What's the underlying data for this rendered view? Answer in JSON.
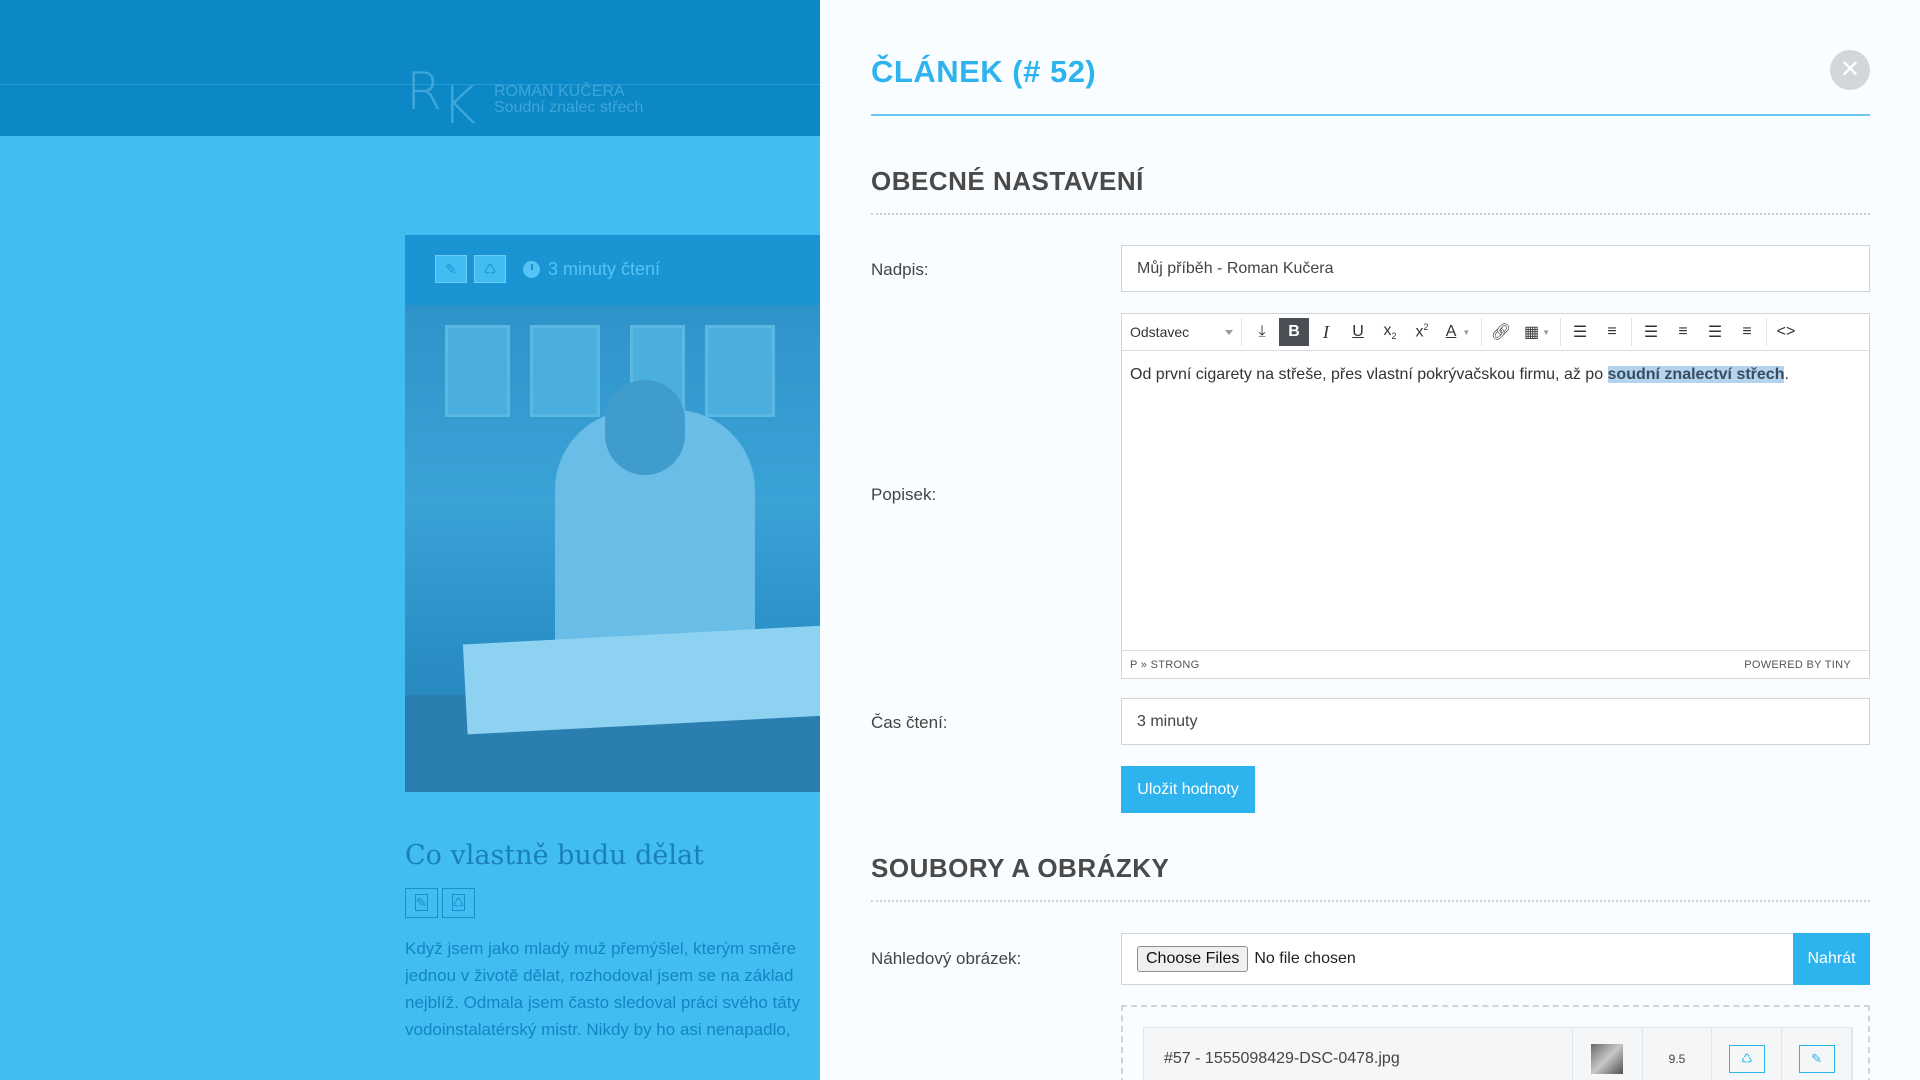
{
  "background": {
    "logo": {
      "mark_r": "R",
      "mark_k": "K",
      "name": "ROMAN KUČERA",
      "tagline": "Soudní znalec střech"
    },
    "card": {
      "edit_icon": "pencil-icon",
      "delete_icon": "recycle-icon",
      "reading_time": "3 minuty čtení"
    },
    "article": {
      "title": "Co vlastně budu dělat",
      "paragraph_lines": [
        "Když jsem jako mladý muž přemýšlel, kterým směre",
        "jednou v životě dělat, rozhodoval jsem se na základ",
        "nejblíž. Odmala jsem často sledoval práci svého táty",
        "vodoinstalatérský mistr. Nikdy by ho asi nenapadlo,"
      ]
    }
  },
  "modal": {
    "title": "ČLÁNEK (# 52)",
    "close_symbol": "✕",
    "general": {
      "heading": "OBECNÉ NASTAVENÍ",
      "title_label": "Nadpis:",
      "title_value": "Můj příběh - Roman Kučera",
      "description_label": "Popisek:",
      "editor": {
        "format_select": "Odstavec",
        "content_prefix": "Od první cigarety na střeše, přes vlastní pokrývačskou firmu, až po ",
        "content_highlight": "soudní znalectví střech",
        "content_suffix": ".",
        "path": "P » STRONG",
        "powered": "POWERED BY TINY"
      },
      "reading_time_label": "Čas čtení:",
      "reading_time_value": "3 minuty",
      "save_label": "Uložit hodnoty"
    },
    "files": {
      "heading": "SOUBORY A OBRÁZKY",
      "preview_label": "Náhledový obrázek:",
      "choose_label": "Choose Files",
      "no_file_text": "No file chosen",
      "upload_label": "Nahrát",
      "rows": [
        {
          "name": "#57 - 1555098429-DSC-0478.jpg",
          "size": "9.5"
        }
      ]
    }
  },
  "colors": {
    "accent": "#2db4ee",
    "overlay": "#42bdf2",
    "topbar": "#0d88c6"
  }
}
